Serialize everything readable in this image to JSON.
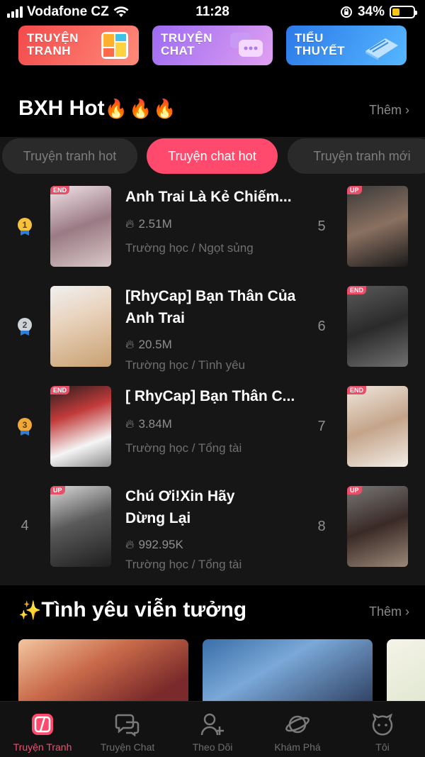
{
  "status_bar": {
    "carrier": "Vodafone CZ",
    "time": "11:28",
    "battery": "34%",
    "battery_level": 0.34
  },
  "categories": [
    {
      "label": "TRUYỆN TRANH"
    },
    {
      "label": "TRUYỆN CHAT"
    },
    {
      "label": "TIỂU THUYẾT"
    }
  ],
  "ranking": {
    "title": "BXH Hot",
    "title_emoji": "🔥🔥🔥",
    "more": "Thêm",
    "tabs": [
      "Truyện tranh hot",
      "Truyện chat hot",
      "Truyện tranh mới"
    ],
    "active_tab": 1,
    "items": [
      {
        "rank": "1",
        "title": "Anh Trai Là Kẻ Chiếm...",
        "views": "2.51M",
        "tags": "Trường học / Ngọt sủng",
        "badge": "END"
      },
      {
        "rank": "2",
        "title": "[RhyCap] Bạn Thân Của Anh Trai",
        "views": "20.5M",
        "tags": "Trường học / Tình yêu",
        "badge": ""
      },
      {
        "rank": "3",
        "title": "[ RhyCap] Bạn Thân C...",
        "views": "3.84M",
        "tags": "Trường học / Tổng tài",
        "badge": "END"
      },
      {
        "rank": "4",
        "title": "Chú Ơi!Xin Hãy Dừng Lại",
        "views": "992.95K",
        "tags": "Trường học / Tổng tài",
        "badge": "UP"
      }
    ],
    "right_column": [
      {
        "rank": "5",
        "badge": "UP"
      },
      {
        "rank": "6",
        "badge": "END"
      },
      {
        "rank": "7",
        "badge": "END"
      },
      {
        "rank": "8",
        "badge": "UP"
      }
    ]
  },
  "section2": {
    "title": "Tình yêu viễn tưởng",
    "emoji": "✨",
    "more": "Thêm"
  },
  "tab_bar": [
    {
      "label": "Truyện Tranh",
      "icon": "comic-icon",
      "active": true
    },
    {
      "label": "Truyện Chat",
      "icon": "chat-icon",
      "active": false
    },
    {
      "label": "Theo Dõi",
      "icon": "follow-user-icon",
      "active": false
    },
    {
      "label": "Khám Phá",
      "icon": "planet-icon",
      "active": false
    },
    {
      "label": "Tôi",
      "icon": "profile-face-icon",
      "active": false
    }
  ]
}
